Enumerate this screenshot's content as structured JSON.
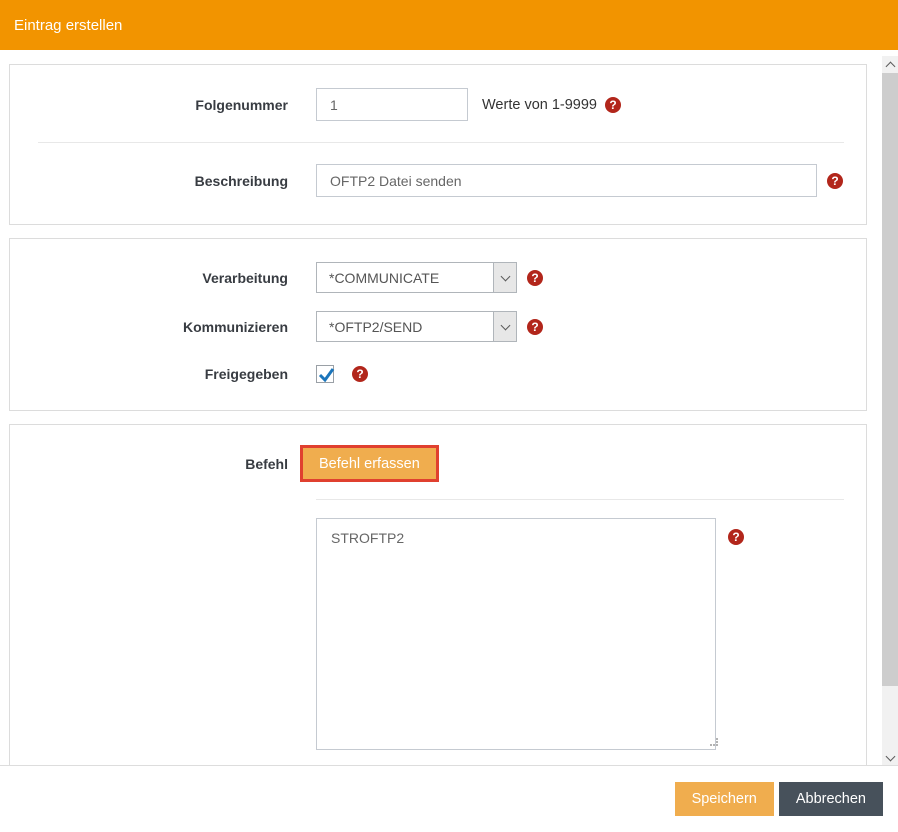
{
  "window": {
    "title": "Eintrag erstellen"
  },
  "form": {
    "folgenummer": {
      "label": "Folgenummer",
      "value": "1",
      "hint": "Werte von 1-9999"
    },
    "beschreibung": {
      "label": "Beschreibung",
      "value": "OFTP2 Datei senden"
    },
    "verarbeitung": {
      "label": "Verarbeitung",
      "selected": "*COMMUNICATE"
    },
    "kommunizieren": {
      "label": "Kommunizieren",
      "selected": "*OFTP2/SEND"
    },
    "freigegeben": {
      "label": "Freigegeben",
      "checked": true
    },
    "befehl": {
      "label": "Befehl",
      "capture_button": "Befehl erfassen",
      "command": "STROFTP2"
    }
  },
  "footer": {
    "save": "Speichern",
    "cancel": "Abbrechen"
  },
  "icons": {
    "help_glyph": "?"
  },
  "colors": {
    "header_bg": "#f29400",
    "primary_button": "#f0ad4e",
    "cancel_button": "#47515b",
    "help_icon": "#b2261b",
    "focus_outline": "#e0402f",
    "checkbox_check": "#1b75bb"
  }
}
